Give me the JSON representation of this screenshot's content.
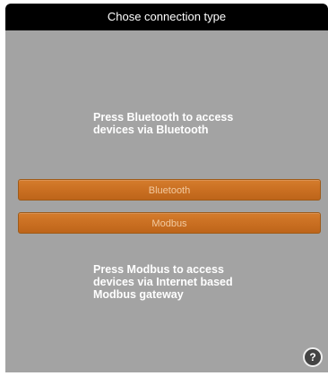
{
  "header": {
    "title": "Chose connection type"
  },
  "instructions": {
    "bluetooth": "Press Bluetooth to access\ndevices via Bluetooth",
    "modbus": "Press Modbus to access\ndevices via Internet based\nModbus gateway"
  },
  "buttons": {
    "bluetooth_label": "Bluetooth",
    "modbus_label": "Modbus"
  },
  "help": {
    "icon": "question-mark-icon",
    "glyph": "?"
  },
  "colors": {
    "panel_background": "#a3a3a3",
    "titlebar_background": "#000000",
    "button_accent": "#c96e21",
    "button_text": "#f2caa0"
  }
}
